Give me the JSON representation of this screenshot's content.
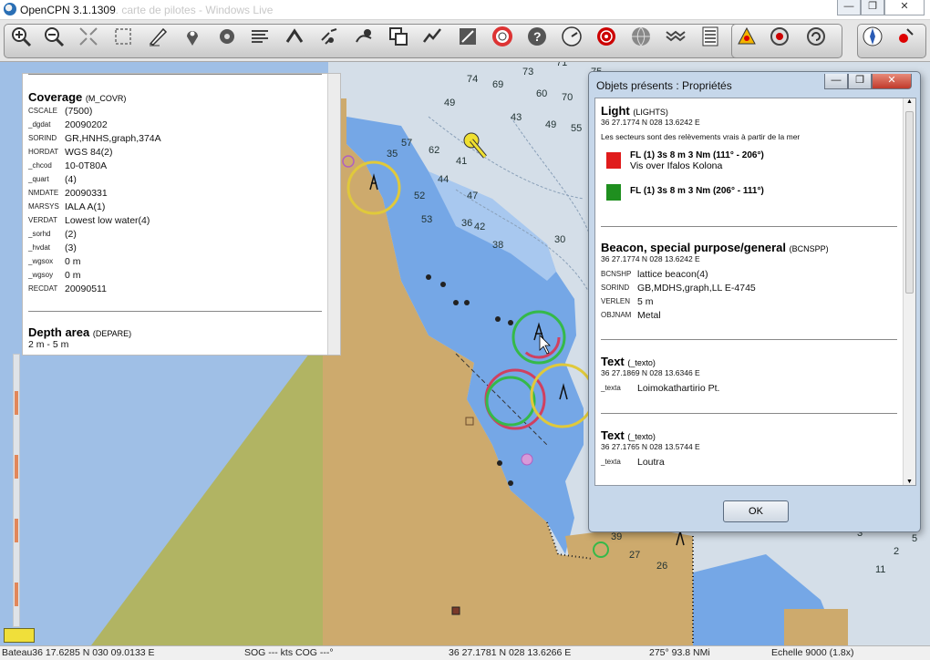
{
  "window": {
    "title": "OpenCPN 3.1.1309",
    "blurred_title": "... carte de pilotes - Windows Live"
  },
  "toolbar": {
    "buttons": [
      {
        "name": "zoom-in",
        "icon": "zoom-in-icon"
      },
      {
        "name": "zoom-out",
        "icon": "zoom-out-icon"
      },
      {
        "name": "scale-in",
        "icon": "scale-in-icon"
      },
      {
        "name": "scale-out",
        "icon": "scale-out-icon"
      },
      {
        "name": "route",
        "icon": "pencil-route-icon"
      },
      {
        "name": "mark",
        "icon": "pin-icon"
      },
      {
        "name": "settings",
        "icon": "gear-icon"
      },
      {
        "name": "text",
        "icon": "text-lines-icon"
      },
      {
        "name": "tide",
        "icon": "tide-icon"
      },
      {
        "name": "current",
        "icon": "current-icon"
      },
      {
        "name": "ais",
        "icon": "ais-icon"
      },
      {
        "name": "copy",
        "icon": "copy-icon"
      },
      {
        "name": "track",
        "icon": "track-icon"
      },
      {
        "name": "chart-quilt",
        "icon": "chart-quilt-icon"
      },
      {
        "name": "mob",
        "icon": "lifebuoy-icon"
      },
      {
        "name": "help",
        "icon": "help-icon"
      },
      {
        "name": "gauge",
        "icon": "gauge-icon"
      },
      {
        "name": "radar",
        "icon": "radar-icon"
      },
      {
        "name": "globe",
        "icon": "globe-icon"
      },
      {
        "name": "waves",
        "icon": "waves-icon"
      },
      {
        "name": "list",
        "icon": "list-icon"
      },
      {
        "name": "alarm",
        "icon": "alarm-icon"
      },
      {
        "name": "rotate-ccw",
        "icon": "rotate-ccw-icon"
      },
      {
        "name": "rotate-cw",
        "icon": "rotate-cw-icon"
      },
      {
        "name": "compass",
        "icon": "compass-icon"
      },
      {
        "name": "gps",
        "icon": "gps-status-icon"
      }
    ]
  },
  "info_panel": {
    "coverage": {
      "title": "Coverage",
      "acronym": "(M_COVR)",
      "attributes": [
        {
          "k": "CSCALE",
          "v": "(7500)"
        },
        {
          "k": "_dgdat",
          "v": "20090202"
        },
        {
          "k": "SORIND",
          "v": "GR,HNHS,graph,374A"
        },
        {
          "k": "HORDAT",
          "v": "WGS 84(2)"
        },
        {
          "k": "_chcod",
          "v": "10-0T80A"
        },
        {
          "k": "_quart",
          "v": "(4)"
        },
        {
          "k": "NMDATE",
          "v": "20090331"
        },
        {
          "k": "MARSYS",
          "v": "IALA A(1)"
        },
        {
          "k": "VERDAT",
          "v": "Lowest low water(4)"
        },
        {
          "k": "_sorhd",
          "v": "(2)"
        },
        {
          "k": "_hvdat",
          "v": "(3)"
        },
        {
          "k": "_wgsox",
          "v": "0 m"
        },
        {
          "k": "_wgsoy",
          "v": "0 m"
        },
        {
          "k": "RECDAT",
          "v": "20090511"
        }
      ]
    },
    "depth": {
      "title": "Depth area",
      "acronym": "(DEPARE)",
      "value": "2 m - 5 m"
    }
  },
  "dialog": {
    "title": "Objets présents : Propriétés",
    "ok_label": "OK",
    "light": {
      "title": "Light",
      "acronym": "(LIGHTS)",
      "coord": "36 27.1774 N 028 13.6242 E",
      "note": "Les secteurs sont des relèvements vrais à partir de la mer",
      "sectors": [
        {
          "color": "#e01b1b",
          "label": "FL (1) 3s 8 m 3 Nm (111° - 206°)",
          "sub": "Vis over Ifalos Kolona"
        },
        {
          "color": "#1f8f1f",
          "label": "FL (1) 3s 8 m 3 Nm (206° - 111°)",
          "sub": ""
        }
      ]
    },
    "beacon": {
      "title": "Beacon, special purpose/general",
      "acronym": "(BCNSPP)",
      "coord": "36 27.1774 N 028 13.6242 E",
      "attributes": [
        {
          "k": "BCNSHP",
          "v": "lattice beacon(4)"
        },
        {
          "k": "SORIND",
          "v": "GB,MDHS,graph,LL E-4745"
        },
        {
          "k": "VERLEN",
          "v": "5 m"
        },
        {
          "k": "OBJNAM",
          "v": "Metal"
        }
      ]
    },
    "text1": {
      "title": "Text",
      "acronym": "(_texto)",
      "coord": "36 27.1869 N 028 13.6346 E",
      "k": "_texta",
      "v": "Loimokathartirio Pt."
    },
    "text2": {
      "title": "Text",
      "acronym": "(_texto)",
      "coord": "36 27.1765 N 028 13.5744 E",
      "k": "_texta",
      "v": "Loutra"
    }
  },
  "status": {
    "boat": "Bateau36 17.6285 N   030 09.0133 E",
    "sog": "SOG --- kts  COG ---°",
    "cursor": "36 27.1781 N   028 13.6266 E",
    "bearing": "275°  93.8 NMi",
    "scale": "Echelle 9000 (1.8x)"
  },
  "map_soundings": [
    "71",
    "73",
    "75",
    "74",
    "69",
    "60",
    "70",
    "49",
    "43",
    "49",
    "55",
    "57",
    "62",
    "41",
    "44",
    "52",
    "47",
    "53",
    "42",
    "38",
    "35",
    "36",
    "30",
    "39",
    "27",
    "26",
    "3",
    "2",
    "11",
    "5"
  ]
}
